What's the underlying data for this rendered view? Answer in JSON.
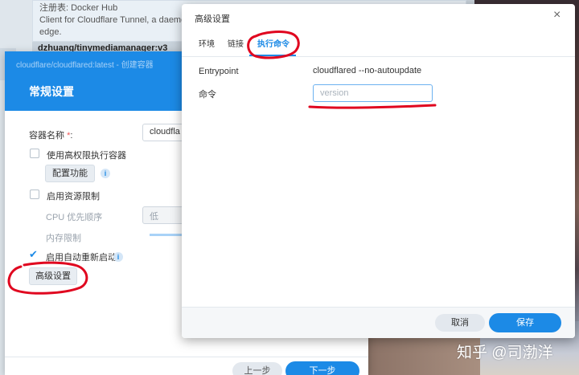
{
  "background": {
    "info_card": {
      "registry_line": "注册表: Docker Hub",
      "description_line": "Client for Cloudflare Tunnel, a daeme",
      "description_tail": "edge."
    },
    "behind_title": "dzhuang/tinymediamanager:v3"
  },
  "wizard": {
    "breadcrumb": "cloudflare/cloudflared:latest - 创建容器",
    "title": "常规设置",
    "container_name_label": "容器名称",
    "required_mark": "*",
    "container_name_suffix": ":",
    "container_name_value": "cloudfla",
    "privileged_label": "使用高权限执行容器",
    "configure_button": "配置功能",
    "resource_limit_label": "启用资源限制",
    "cpu_priority_label": "CPU 优先顺序",
    "cpu_priority_value": "低",
    "memory_limit_label": "内存限制",
    "auto_restart_label": "启用自动重新启动",
    "auto_restart_checked": true,
    "advanced_button": "高级设置",
    "prev_button": "上一步",
    "next_button": "下一步"
  },
  "advanced_dialog": {
    "title": "高级设置",
    "close_symbol": "×",
    "tabs": [
      {
        "label": "环境",
        "active": false
      },
      {
        "label": "链接",
        "active": false
      },
      {
        "label": "执行命令",
        "active": true
      }
    ],
    "entrypoint_label": "Entrypoint",
    "entrypoint_value": "cloudflared --no-autoupdate",
    "command_label": "命令",
    "command_placeholder": "version",
    "command_value": "",
    "cancel_button": "取消",
    "save_button": "保存"
  },
  "watermark": "知乎 @司渤洋",
  "colors": {
    "accent": "#1c8ae6",
    "annotation_red": "#e0061f"
  }
}
